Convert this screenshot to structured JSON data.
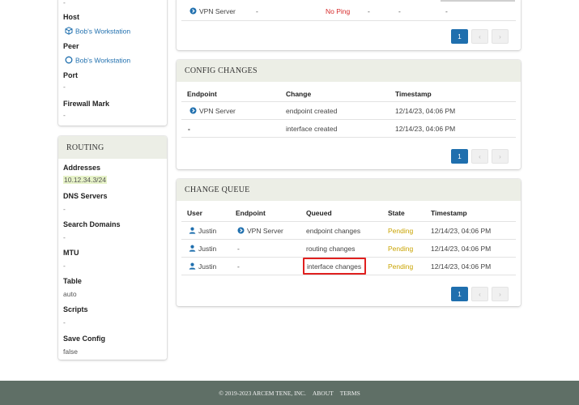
{
  "left_panel": {
    "top_dash": "-",
    "host_label": "Host",
    "host_value": "Bob's Workstation",
    "peer_label": "Peer",
    "peer_value": "Bob's Workstation",
    "port_label": "Port",
    "port_value": "-",
    "firewall_label": "Firewall Mark",
    "firewall_value": "-"
  },
  "routing": {
    "title": "ROUTING",
    "addresses_label": "Addresses",
    "addresses_value": "10.12.34.3/24",
    "dns_label": "DNS Servers",
    "dns_value": "-",
    "search_label": "Search Domains",
    "search_value": "-",
    "mtu_label": "MTU",
    "mtu_value": "-",
    "table_label": "Table",
    "table_value": "auto",
    "scripts_label": "Scripts",
    "scripts_value": "-",
    "save_label": "Save Config",
    "save_value": "false"
  },
  "endpoints_top": {
    "row": {
      "endpoint": "VPN Server",
      "c1": "-",
      "ping": "No Ping",
      "c3": "-",
      "c4": "-",
      "c5": "-"
    },
    "pager": {
      "page": "1",
      "prev": "‹",
      "next": "›"
    }
  },
  "config_changes": {
    "title": "CONFIG CHANGES",
    "headers": {
      "endpoint": "Endpoint",
      "change": "Change",
      "timestamp": "Timestamp"
    },
    "rows": [
      {
        "endpoint": "VPN Server",
        "change": "endpoint created",
        "timestamp": "12/14/23, 04:06 PM"
      },
      {
        "endpoint": "-",
        "change": "interface created",
        "timestamp": "12/14/23, 04:06 PM"
      }
    ],
    "pager": {
      "page": "1",
      "prev": "‹",
      "next": "›"
    }
  },
  "change_queue": {
    "title": "CHANGE QUEUE",
    "headers": {
      "user": "User",
      "endpoint": "Endpoint",
      "queued": "Queued",
      "state": "State",
      "timestamp": "Timestamp"
    },
    "rows": [
      {
        "user": "Justin",
        "endpoint": "VPN Server",
        "queued": "endpoint changes",
        "state": "Pending",
        "timestamp": "12/14/23, 04:06 PM"
      },
      {
        "user": "Justin",
        "endpoint": "-",
        "queued": "routing changes",
        "state": "Pending",
        "timestamp": "12/14/23, 04:06 PM"
      },
      {
        "user": "Justin",
        "endpoint": "-",
        "queued": "interface changes",
        "state": "Pending",
        "timestamp": "12/14/23, 04:06 PM"
      }
    ],
    "pager": {
      "page": "1",
      "prev": "‹",
      "next": "›"
    }
  },
  "footer": {
    "copyright": "© 2019-2023 ARCEM TENE, INC.",
    "about": "ABOUT",
    "terms": "TERMS"
  },
  "colors": {
    "accent": "#1f6fae",
    "pending": "#c9a300",
    "error": "#d62b2b",
    "highlight_box": "#e0201f",
    "footer_bg": "#5f6f66",
    "header_bg": "#eceee6"
  }
}
